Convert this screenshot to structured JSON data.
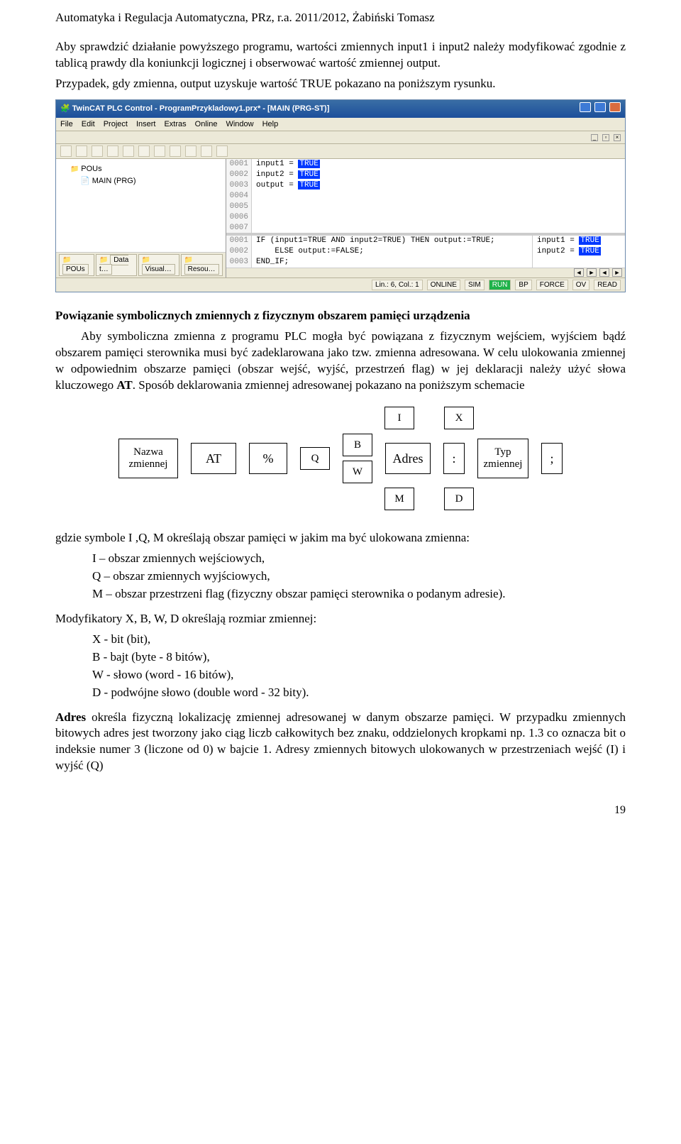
{
  "header": "Automatyka i Regulacja Automatyczna, PRz, r.a. 2011/2012, Żabiński Tomasz",
  "intro1": "Aby sprawdzić działanie powyższego programu, wartości zmiennych input1 i input2 należy modyfikować zgodnie z tablicą prawdy dla koniunkcji logicznej i obserwować wartość zmiennej output.",
  "intro2": "Przypadek, gdy zmienna, output uzyskuje wartość TRUE pokazano na poniższym rysunku.",
  "app": {
    "title": "TwinCAT PLC Control - ProgramPrzykladowy1.prx* - [MAIN (PRG-ST)]",
    "menus": [
      "File",
      "Edit",
      "Project",
      "Insert",
      "Extras",
      "Online",
      "Window",
      "Help"
    ],
    "tree_head": "POUs",
    "tree_item": "MAIN (PRG)",
    "bottom_tabs": [
      "POUs",
      "Data t…",
      "Visual…",
      "Resou…"
    ],
    "vars": {
      "l1_num": "0001",
      "l1": "input1 = ",
      "l2_num": "0002",
      "l2": "input2 = ",
      "l3_num": "0003",
      "l3": "output = ",
      "l4_num": "0004",
      "l5_num": "0005",
      "l6_num": "0006",
      "l7_num": "0007",
      "true": "TRUE"
    },
    "code": {
      "l1_num": "0001",
      "l1": "IF (input1=TRUE AND input2=TRUE) THEN output:=TRUE;",
      "l2_num": "0002",
      "l2": "    ELSE output:=FALSE;",
      "l3_num": "0003",
      "l3": "END_IF;",
      "side1": "input1 = ",
      "side2": "input2 = "
    },
    "status": {
      "pos": "Lin.: 6, Col.: 1",
      "online": "ONLINE",
      "sim": "SIM",
      "run": "RUN",
      "bp": "BP",
      "force": "FORCE",
      "ov": "OV",
      "read": "READ"
    }
  },
  "sec_title": "Powiązanie symbolicznych zmiennych z fizycznym obszarem pamięci urządzenia",
  "para_link1": "Aby symboliczna zmienna z programu PLC mogła być powiązana z fizycznym wejściem, wyjściem bądź obszarem pamięci sterownika musi być zadeklarowana jako tzw. zmienna adresowana. W celu ulokowania zmiennej w odpowiednim obszarze pamięci (obszar wejść, wyjść, przestrzeń flag) w jej deklaracji należy użyć słowa kluczowego ",
  "AT": "AT",
  "para_link2": ". Sposób deklarowania zmiennej adresowanej pokazano na poniższym schemacie",
  "diagram": {
    "nazwa": "Nazwa\nzmiennej",
    "at": "AT",
    "pct": "%",
    "I": "I",
    "Q": "Q",
    "M": "M",
    "X": "X",
    "B": "B",
    "W": "W",
    "D": "D",
    "adres": "Adres",
    "colon": ":",
    "typ": "Typ\nzmiennej",
    "semi": ";"
  },
  "below1": "gdzie symbole I ,Q, M określają obszar pamięci w jakim ma być ulokowana zmienna:",
  "bl1": "I – obszar zmiennych wejściowych,",
  "bl2": "Q – obszar zmiennych wyjściowych,",
  "bl3": "M – obszar przestrzeni flag (fizyczny obszar pamięci sterownika o podanym adresie).",
  "below2": "Modyfikatory X, B, W, D określają rozmiar zmiennej:",
  "bl4": "X -  bit (bit),",
  "bl5": "B -  bajt (byte - 8 bitów),",
  "bl6": "W -  słowo (word - 16 bitów),",
  "bl7": "D -  podwójne słowo (double word - 32 bity).",
  "adres_para_a": "Adres",
  "adres_para_b": " określa fizyczną lokalizację zmiennej adresowanej w danym obszarze pamięci. W przypadku zmiennych bitowych adres jest tworzony jako ciąg liczb całkowitych bez znaku, oddzielonych kropkami np. 1.3 co oznacza bit o indeksie numer 3 (liczone od 0) w bajcie 1. Adresy zmiennych bitowych ulokowanych w przestrzeniach wejść (I) i wyjść (Q)",
  "pagenum": "19"
}
